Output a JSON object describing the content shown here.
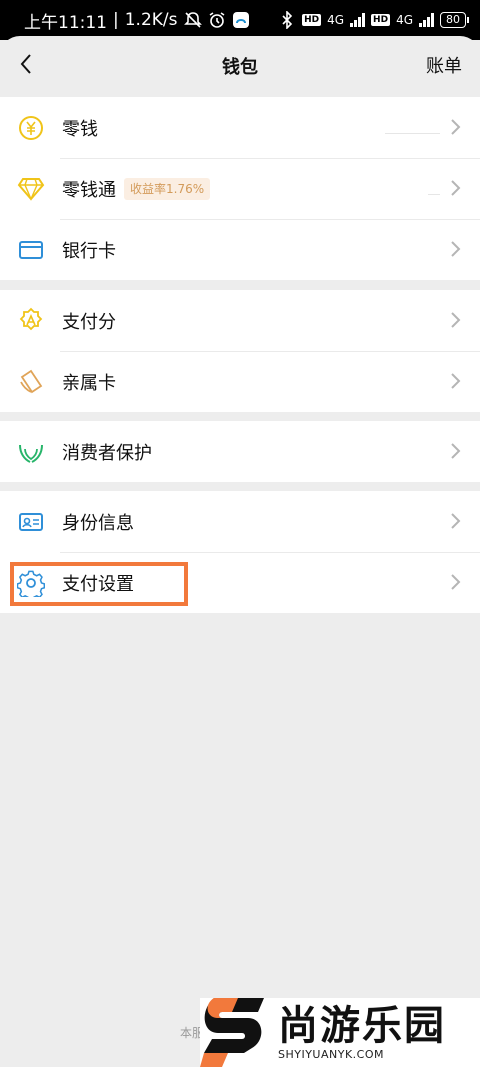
{
  "status_bar": {
    "time": "上午11:11",
    "speed": "1.2K/s",
    "battery": "80",
    "hd1": "HD",
    "net1": "4G",
    "hd2": "HD",
    "net2": "4G",
    "icons": [
      "mute-bell-icon",
      "alarm-icon",
      "app-notification-icon",
      "bluetooth-icon",
      "signal-icon",
      "battery-icon"
    ]
  },
  "nav": {
    "title": "钱包",
    "right_label": "账单",
    "back_icon": "chevron-left-icon"
  },
  "groups": [
    {
      "items": [
        {
          "label": "零钱",
          "icon": "yuan-coin-icon"
        },
        {
          "label": "零钱通",
          "icon": "diamond-icon",
          "tag": "收益率1.76%"
        },
        {
          "label": "银行卡",
          "icon": "bank-card-icon"
        }
      ]
    },
    {
      "items": [
        {
          "label": "支付分",
          "icon": "pay-score-icon"
        },
        {
          "label": "亲属卡",
          "icon": "family-card-icon"
        }
      ]
    },
    {
      "items": [
        {
          "label": "消费者保护",
          "icon": "shield-hands-icon"
        }
      ]
    },
    {
      "items": [
        {
          "label": "身份信息",
          "icon": "id-card-icon"
        },
        {
          "label": "支付设置",
          "icon": "gear-icon"
        }
      ]
    }
  ],
  "footer_note": "本服",
  "watermark": {
    "cn": "尚游乐园",
    "en": "SHYIYUANYK.COM"
  },
  "colors": {
    "accent_yellow": "#f0c419",
    "accent_blue": "#2f8fd8",
    "accent_green": "#27b56a",
    "highlight_orange": "#f2793c",
    "background": "#ededed"
  }
}
